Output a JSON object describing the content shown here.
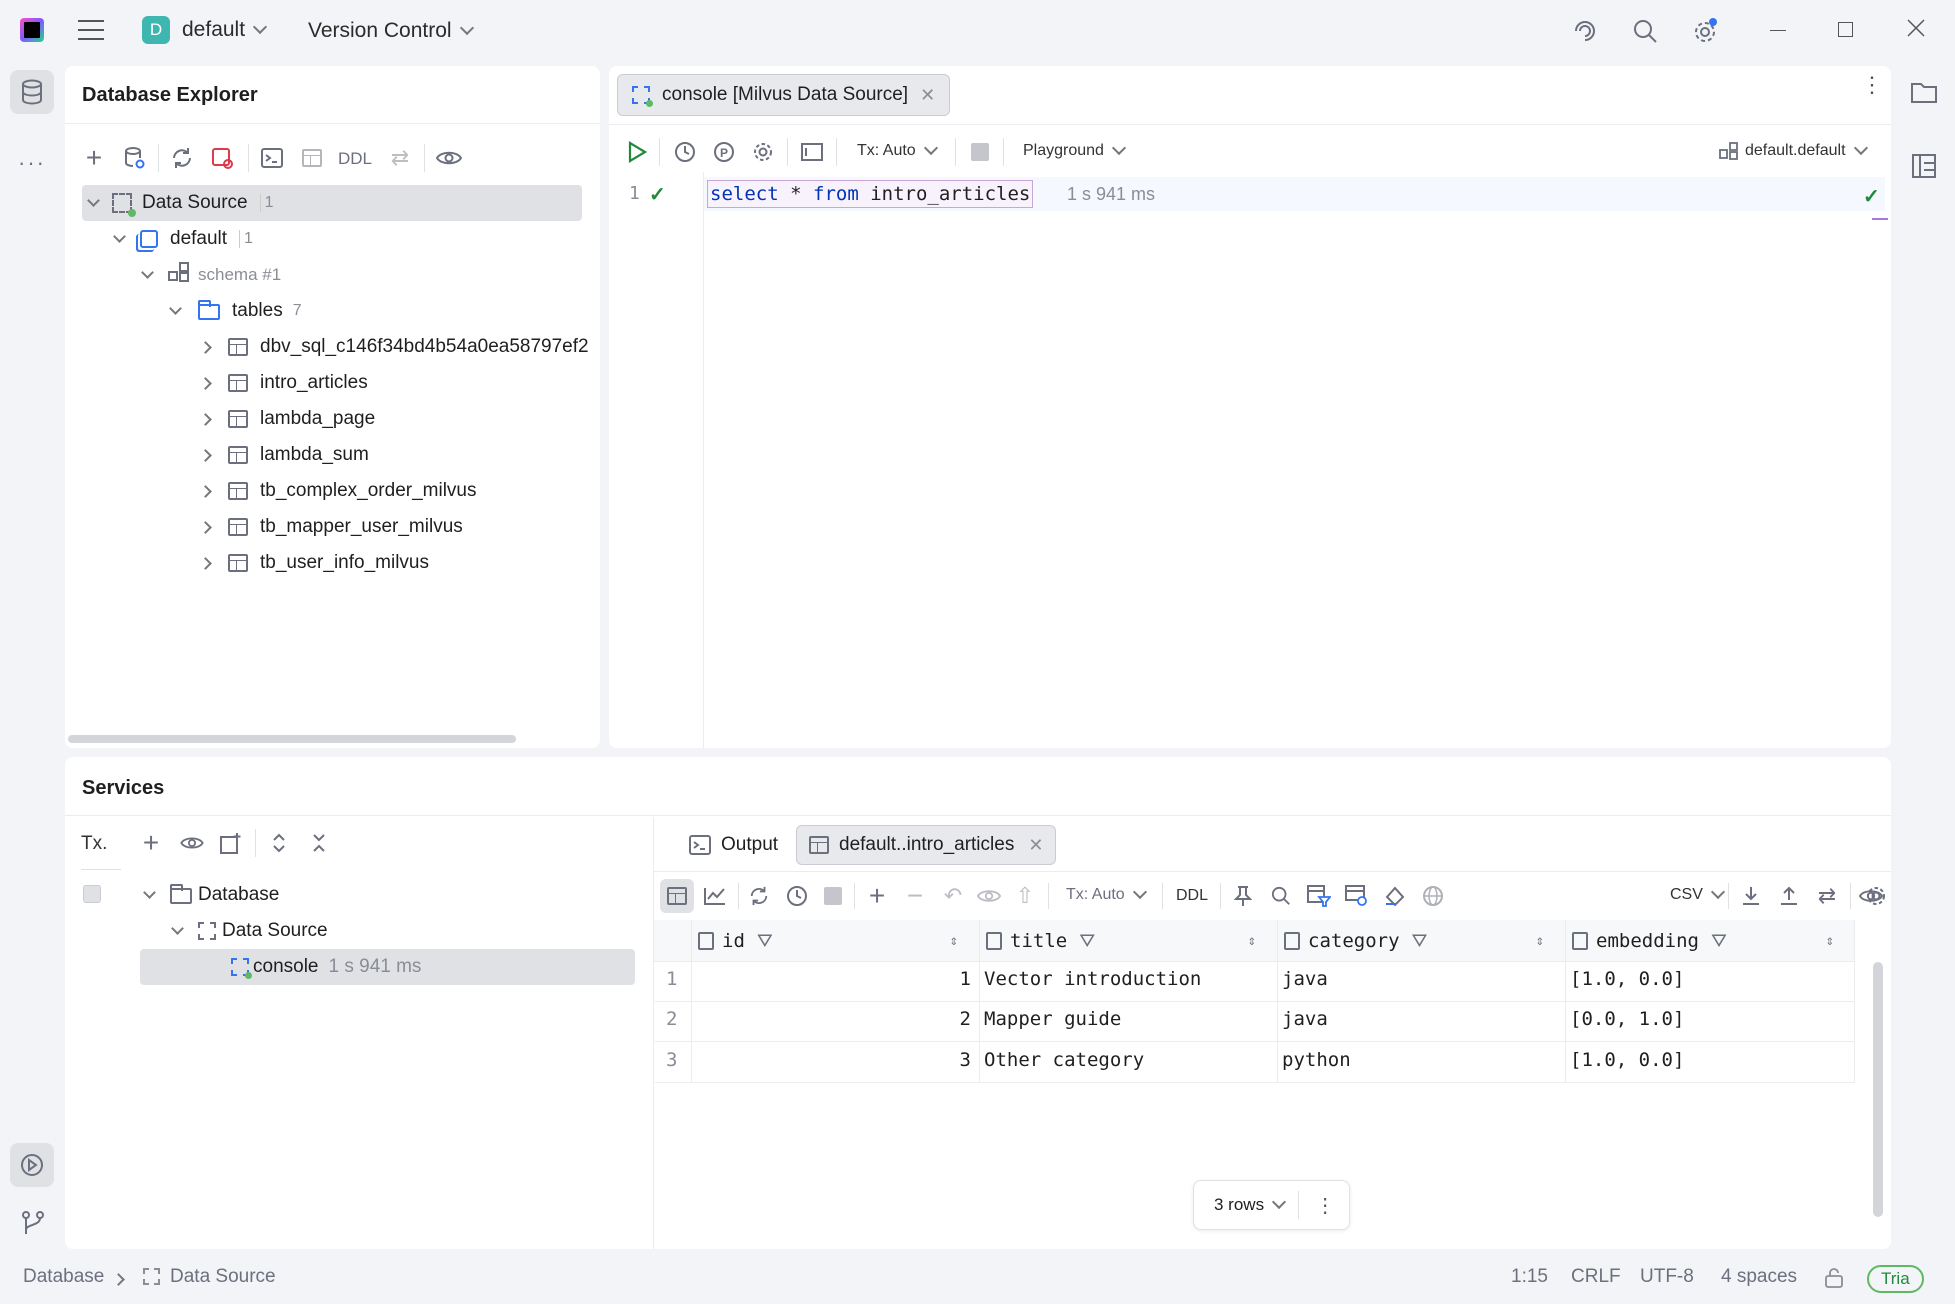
{
  "titlebar": {
    "project_letter": "D",
    "project_name": "default",
    "vcs_label": "Version Control"
  },
  "db_explorer": {
    "title": "Database Explorer",
    "toolbar_ddl": "DDL",
    "tree": {
      "datasource": {
        "label": "Data Source",
        "count": "1"
      },
      "database": {
        "label": "default",
        "count": "1"
      },
      "schema": {
        "label": "schema #1"
      },
      "tables": {
        "label": "tables",
        "count": "7"
      },
      "table_items": [
        "dbv_sql_c146f34bd4b54a0ea58797ef2",
        "intro_articles",
        "lambda_page",
        "lambda_sum",
        "tb_complex_order_milvus",
        "tb_mapper_user_milvus",
        "tb_user_info_milvus"
      ]
    }
  },
  "editor": {
    "tab_label": "console [Milvus Data Source]",
    "tx_label": "Tx: Auto",
    "playground_label": "Playground",
    "schema_label": "default.default",
    "line_number": "1",
    "query": {
      "kw1": "select",
      "star": "*",
      "kw2": "from",
      "table": "intro_articles"
    },
    "exec_time": "1 s 941 ms"
  },
  "services": {
    "title": "Services",
    "tx_label": "Tx.",
    "tree": {
      "database": "Database",
      "datasource": "Data Source",
      "console": "console",
      "console_time": "1 s 941 ms"
    },
    "tabs": {
      "output": "Output",
      "result": "default..intro_articles"
    },
    "toolbar": {
      "tx_label": "Tx: Auto",
      "ddl": "DDL",
      "export_format": "CSV"
    },
    "grid": {
      "columns": [
        "id",
        "title",
        "category",
        "embedding"
      ],
      "rows": [
        {
          "num": "1",
          "id": "1",
          "title": "Vector introduction",
          "category": "java",
          "embedding": "[1.0, 0.0]"
        },
        {
          "num": "2",
          "id": "2",
          "title": "Mapper guide",
          "category": "java",
          "embedding": "[0.0, 1.0]"
        },
        {
          "num": "3",
          "id": "3",
          "title": "Other category",
          "category": "python",
          "embedding": "[1.0, 0.0]"
        }
      ],
      "row_count_label": "3 rows"
    }
  },
  "statusbar": {
    "breadcrumb_1": "Database",
    "breadcrumb_2": "Data Source",
    "position": "1:15",
    "line_sep": "CRLF",
    "encoding": "UTF-8",
    "indent": "4 spaces",
    "badge": "Tria"
  },
  "colors": {
    "accent": "#3574f0",
    "keyword": "#0033b3",
    "run_green": "#208a3c",
    "selection": "#dfe1e5"
  }
}
